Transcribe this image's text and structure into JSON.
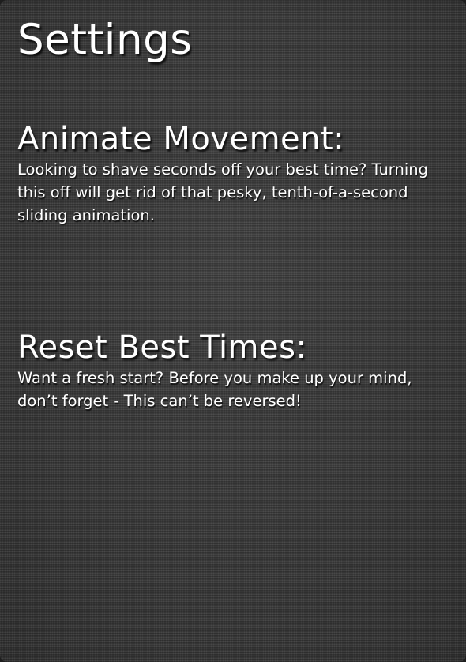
{
  "page": {
    "title": "Settings"
  },
  "sections": {
    "animate_movement": {
      "heading": "Animate Movement:",
      "description": "Looking to shave seconds off your best time? Turning this off will get rid of that pesky, tenth-of-a-second sliding animation."
    },
    "reset_best_times": {
      "heading": "Reset Best Times:",
      "description": "Want a fresh start? Before you make up your mind, don’t forget - This can’t be reversed!"
    }
  },
  "colors": {
    "background": "#3d3d3d",
    "text": "#ffffff"
  }
}
